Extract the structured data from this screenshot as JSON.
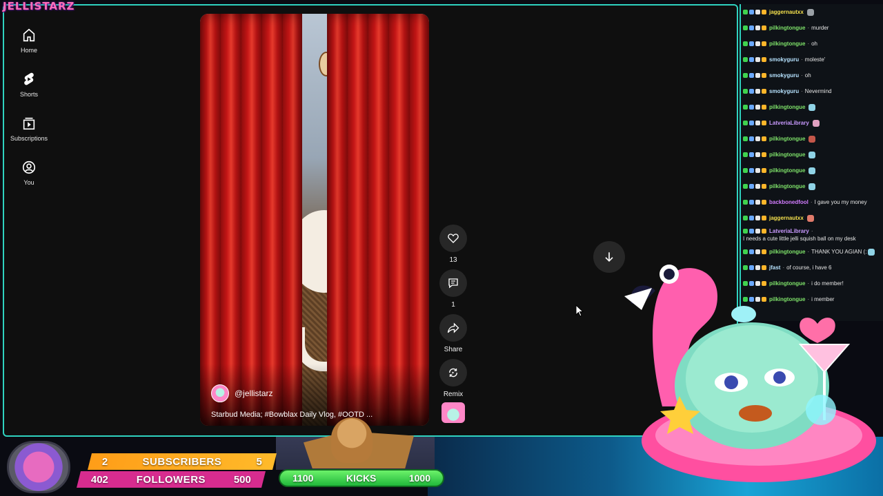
{
  "overlay": {
    "channel_logo": "JELLISTARZ",
    "subs": {
      "current": "2",
      "label": "SUBSCRIBERS",
      "goal": "5"
    },
    "followers": {
      "current": "402",
      "label": "FOLLOWERS",
      "goal": "500"
    },
    "kicks": {
      "current": "1100",
      "label": "KICKS",
      "goal": "1000"
    }
  },
  "rail": {
    "items": [
      {
        "label": "Home",
        "icon": "home-icon"
      },
      {
        "label": "Shorts",
        "icon": "shorts-icon"
      },
      {
        "label": "Subscriptions",
        "icon": "subscriptions-icon"
      },
      {
        "label": "You",
        "icon": "you-icon"
      }
    ]
  },
  "short": {
    "handle": "@jellistarz",
    "title": "Starbud Media; #Bowblax Daily Vlog, #OOTD ...",
    "likes": "13",
    "comments": "1",
    "share_label": "Share",
    "remix_label": "Remix"
  },
  "chat": {
    "messages": [
      {
        "user": "jaggernautxx",
        "text": "",
        "color": "#f4e04d",
        "emote": "#9aa0a6"
      },
      {
        "user": "pilkingtongue",
        "text": "murder",
        "color": "#7fe36a",
        "emote": ""
      },
      {
        "user": "pilkingtongue",
        "text": "oh",
        "color": "#7fe36a",
        "emote": ""
      },
      {
        "user": "smokyguru",
        "text": "moleste'",
        "color": "#b7e3ff",
        "emote": ""
      },
      {
        "user": "smokyguru",
        "text": "oh",
        "color": "#b7e3ff",
        "emote": ""
      },
      {
        "user": "smokyguru",
        "text": "Nevermind",
        "color": "#b7e3ff",
        "emote": ""
      },
      {
        "user": "pilkingtongue",
        "text": "",
        "color": "#7fe36a",
        "emote": "#8fd3e6"
      },
      {
        "user": "LatveriaLibrary",
        "text": "",
        "color": "#c99aff",
        "emote": "#e0a0c0"
      },
      {
        "user": "pilkingtongue",
        "text": "",
        "color": "#7fe36a",
        "emote": "#c4574a"
      },
      {
        "user": "pilkingtongue",
        "text": "",
        "color": "#7fe36a",
        "emote": "#8fd3e6"
      },
      {
        "user": "pilkingtongue",
        "text": "",
        "color": "#7fe36a",
        "emote": "#8fd3e6"
      },
      {
        "user": "pilkingtongue",
        "text": "",
        "color": "#7fe36a",
        "emote": "#8fd3e6"
      },
      {
        "user": "backbonedfool",
        "text": "I gave you my money",
        "color": "#d27cff",
        "emote": ""
      },
      {
        "user": "jaggernautxx",
        "text": "",
        "color": "#f4e04d",
        "emote": "#e07a6a"
      },
      {
        "user": "LatveriaLibrary",
        "text": "I needs a cute little jelli squish ball on my desk",
        "color": "#c99aff",
        "emote": ""
      },
      {
        "user": "pilkingtongue",
        "text": "THANK YOU AGIAN (:",
        "color": "#7fe36a",
        "emote": "#8fd3e6"
      },
      {
        "user": "jfast",
        "text": "of course, i have 6",
        "color": "#b7e3ff",
        "emote": ""
      },
      {
        "user": "pilkingtongue",
        "text": "i do member!",
        "color": "#7fe36a",
        "emote": ""
      },
      {
        "user": "pilkingtongue",
        "text": "i member",
        "color": "#7fe36a",
        "emote": ""
      }
    ]
  },
  "colors": {
    "frame_border": "#2fd3c0",
    "action_bg": "#272727",
    "subs_bar": "#ffae22",
    "followers_bar": "#d72c8f",
    "kicks_bar": "#3fd24f"
  }
}
